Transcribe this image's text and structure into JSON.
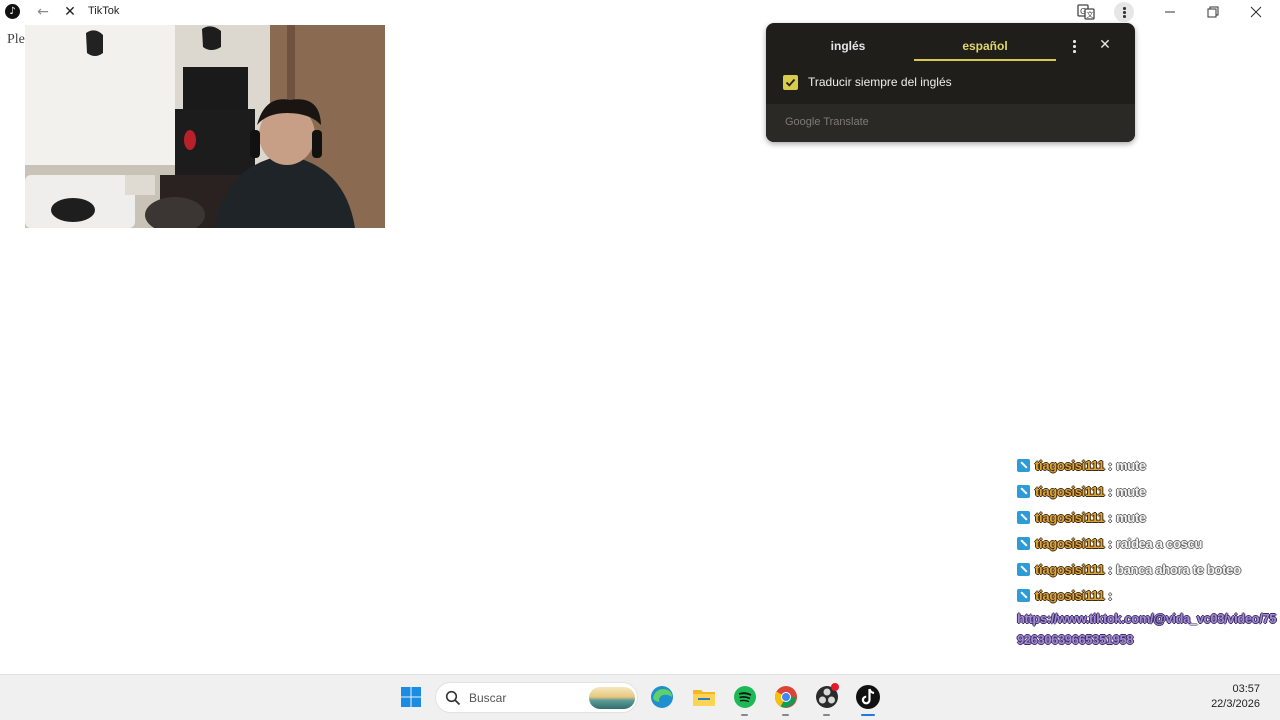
{
  "window": {
    "title": "TikTok",
    "app_icon": "tiktok-icon",
    "back_icon": "back-arrow-icon",
    "stop_icon": "stop-loading-icon",
    "translate_icon": "translate-icon",
    "menu_icon": "more-vertical-icon"
  },
  "page": {
    "partial_text": "Ple"
  },
  "translate_popup": {
    "tabs": [
      {
        "label": "inglés",
        "selected": false
      },
      {
        "label": "español",
        "selected": true
      }
    ],
    "always_translate_label": "Traducir siempre del inglés",
    "always_translate_checked": true,
    "brand": "Google Translate",
    "accent_color": "#d6c94c"
  },
  "chat": {
    "messages": [
      {
        "user": "tiagosisi111",
        "sep": " : ",
        "text": "mute"
      },
      {
        "user": "tiagosisi111",
        "sep": " : ",
        "text": "mute"
      },
      {
        "user": "tiagosisi111",
        "sep": " : ",
        "text": "mute"
      },
      {
        "user": "tiagosisi111",
        "sep": " : ",
        "text": "raidea a coscu"
      },
      {
        "user": "tiagosisi111",
        "sep": " : ",
        "text": "banca ahora te boteo"
      },
      {
        "user": "tiagosisi111",
        "sep": " :",
        "text": "",
        "link": "https://www.tiktok.com/@vida_vc03/video/7592630639665351958"
      }
    ]
  },
  "taskbar": {
    "search_placeholder": "Buscar",
    "apps": [
      "windows-start-icon",
      "edge-icon",
      "file-explorer-icon",
      "spotify-icon",
      "chrome-icon",
      "obs-icon",
      "tiktok-icon"
    ],
    "time": "03:57",
    "date": "22/3/2026"
  }
}
